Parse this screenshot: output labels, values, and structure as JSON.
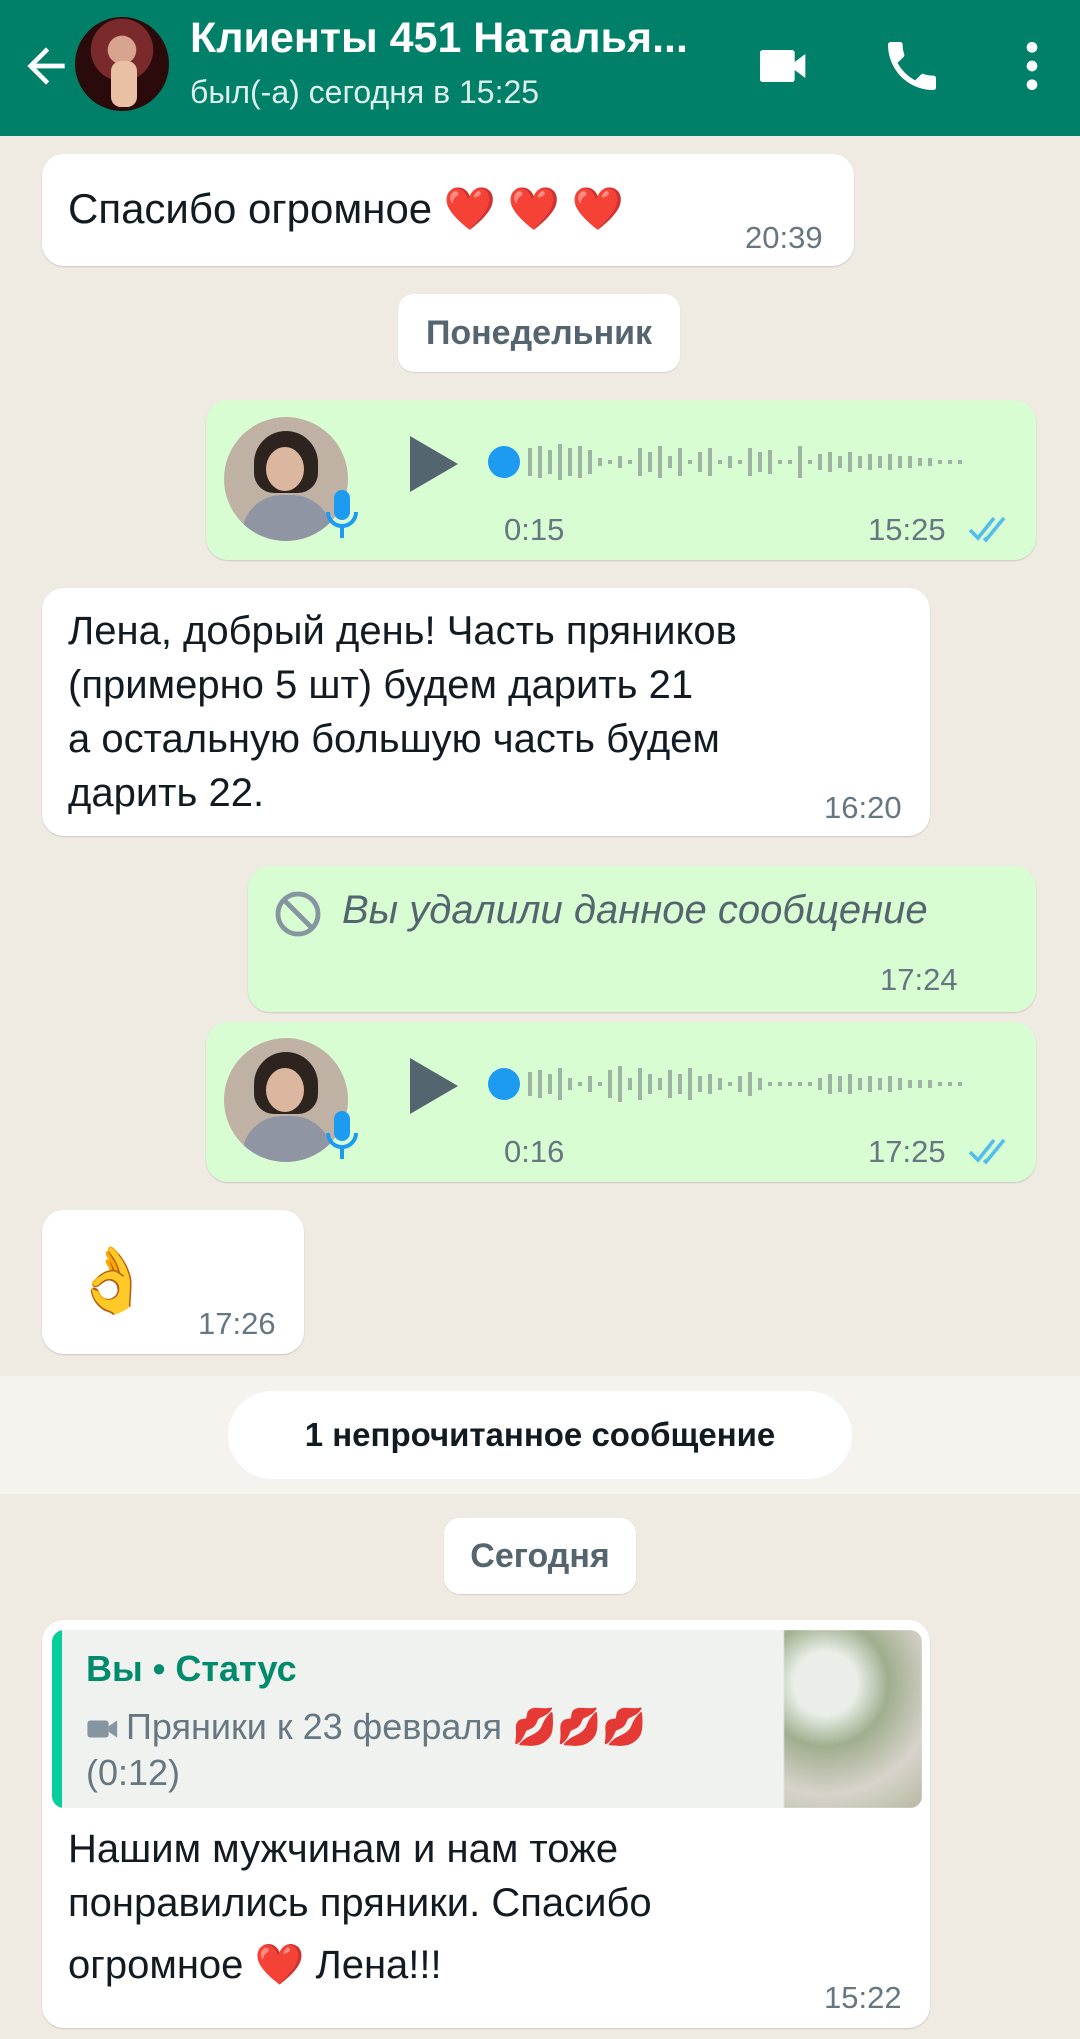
{
  "header": {
    "title": "Клиенты 451 Наталья...",
    "subtitle": "был(-а) сегодня в 15:25",
    "bg_color": "#008069"
  },
  "messages": {
    "m1": {
      "text": "Спасибо огромное ❤️ ❤️ ❤️",
      "time": "20:39"
    },
    "date1": "Понедельник",
    "voice1": {
      "duration": "0:15",
      "time": "15:25"
    },
    "m2": {
      "line1": "Лена, добрый день! Часть пряников",
      "line2": "(примерно 5 шт) будем дарить 21",
      "line3": "а остальную большую часть будем",
      "line4": "дарить 22.",
      "time": "16:20"
    },
    "deleted": {
      "text": "Вы удалили данное сообщение",
      "time": "17:24"
    },
    "voice2": {
      "duration": "0:16",
      "time": "17:25"
    },
    "m3": {
      "text": "👌",
      "time": "17:26"
    },
    "unread": "1 непрочитанное сообщение",
    "date2": "Сегодня",
    "m4": {
      "quote_author": "Вы • Статус",
      "quote_text": "Пряники к 23 февраля 💋💋💋",
      "quote_duration": "(0:12)",
      "line1": "Нашим мужчинам и нам тоже",
      "line2": "понравились пряники. Спасибо",
      "line3": "огромное ❤️ Лена!!!",
      "time": "15:22"
    }
  },
  "colors": {
    "outgoing_bubble": "#d9fdd3",
    "incoming_bubble": "#ffffff",
    "read_ticks": "#53bdeb",
    "accent": "#008069"
  },
  "icons": [
    "back-arrow-icon",
    "video-call-icon",
    "phone-icon",
    "more-vert-icon",
    "play-icon",
    "mic-icon",
    "double-check-icon",
    "ban-icon",
    "video-small-icon"
  ]
}
